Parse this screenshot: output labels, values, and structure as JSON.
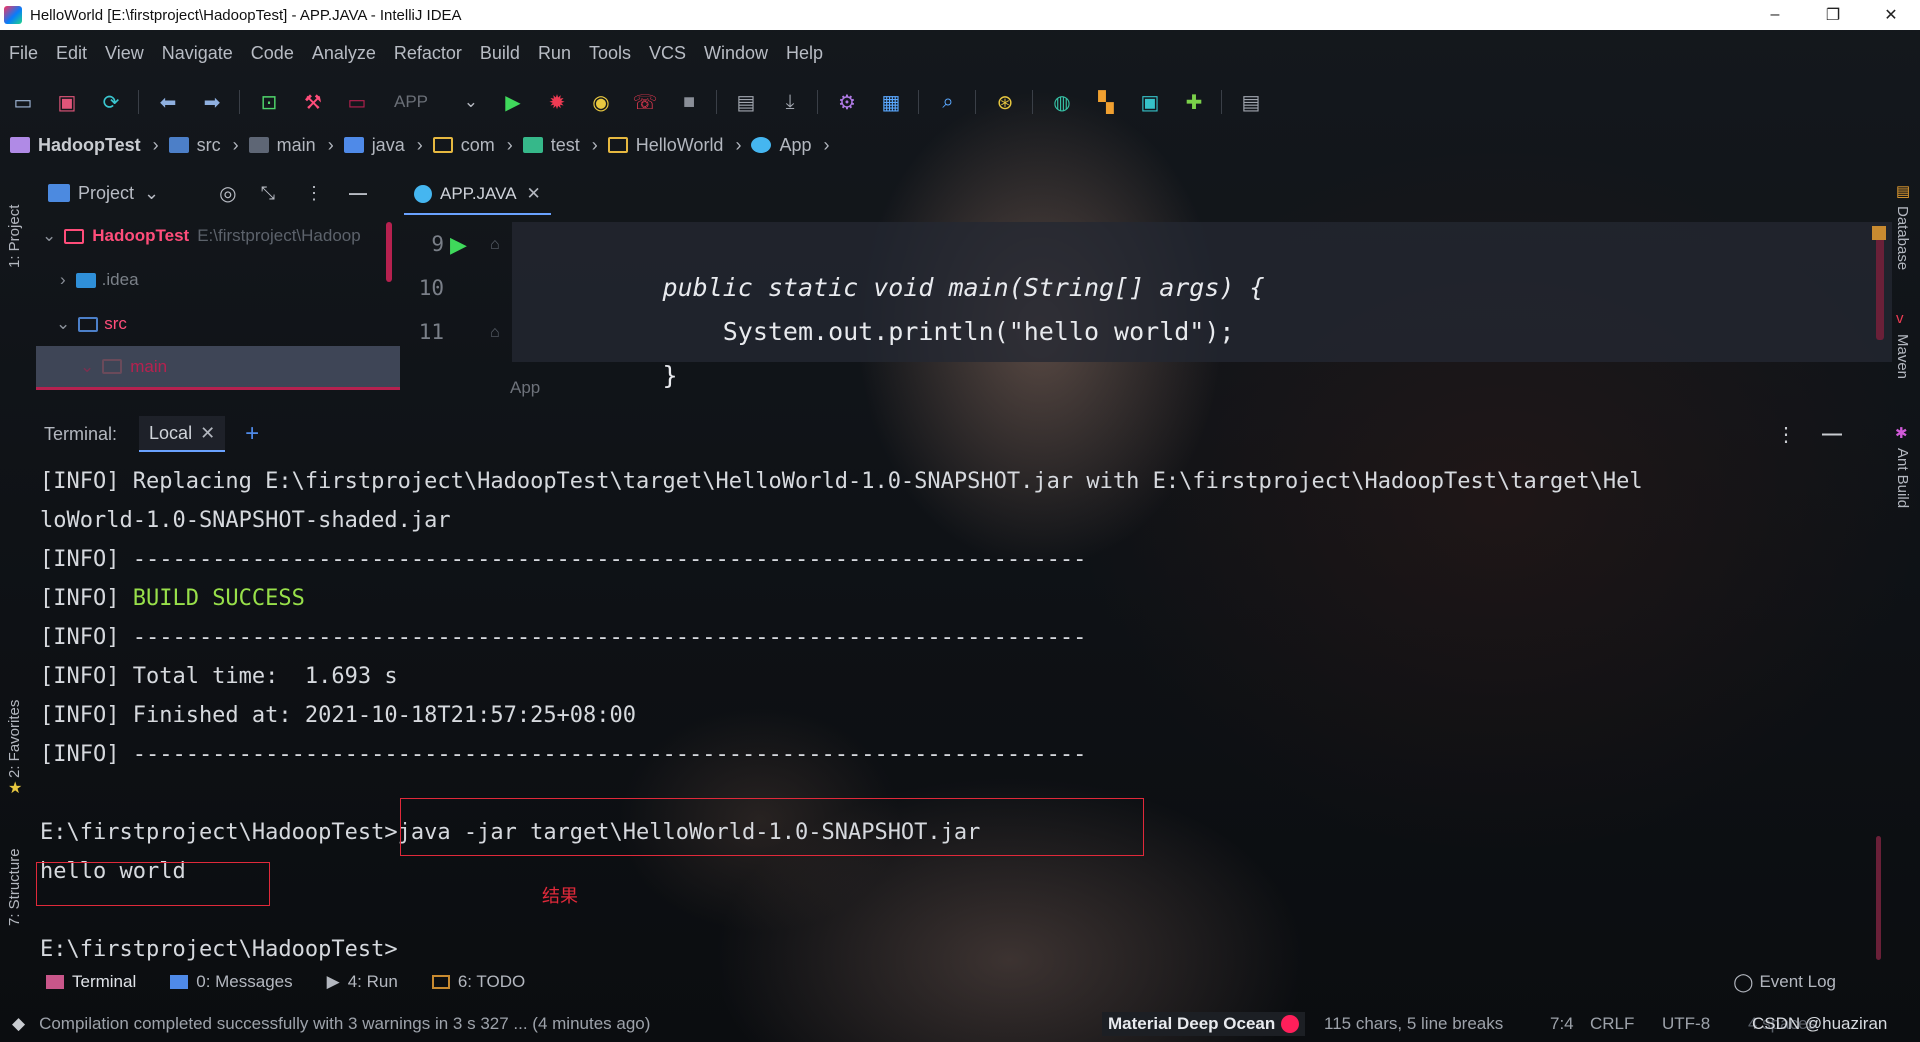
{
  "window": {
    "title": "HelloWorld [E:\\firstproject\\HadoopTest] - APP.JAVA - IntelliJ IDEA",
    "minimize": "–",
    "restore": "❐",
    "close": "✕"
  },
  "menu": [
    "File",
    "Edit",
    "View",
    "Navigate",
    "Code",
    "Analyze",
    "Refactor",
    "Build",
    "Run",
    "Tools",
    "VCS",
    "Window",
    "Help"
  ],
  "toolbar": {
    "run_config": "APP",
    "icons": [
      "open-folder-icon",
      "save-icon",
      "sync-icon",
      "back-icon",
      "forward-icon",
      "terminal-icon",
      "build-hammer-icon",
      "config-icon",
      "run-icon",
      "debug-icon",
      "coverage-icon",
      "profile-icon",
      "stop-icon",
      "ant-icon",
      "download-icon",
      "settings-icon",
      "structure-icon",
      "search-icon",
      "plugin-icon",
      "sdk-icon",
      "layout-icon",
      "dashboard-icon",
      "puzzle-icon",
      "presentation-icon"
    ]
  },
  "breadcrumb": [
    "HadoopTest",
    "src",
    "main",
    "java",
    "com",
    "test",
    "HelloWorld",
    "App"
  ],
  "left_stripe": {
    "project": "1: Project",
    "favorites": "2: Favorites",
    "structure": "7: Structure"
  },
  "right_stripe": {
    "database": "Database",
    "maven": "Maven",
    "ant": "Ant Build"
  },
  "project_panel": {
    "title": "Project",
    "root": {
      "name": "HadoopTest",
      "path": "E:\\firstproject\\Hadoop"
    },
    "items": [
      ".idea",
      "src",
      "main"
    ]
  },
  "editor": {
    "tab": "APP.JAVA",
    "lines": [
      {
        "num": "9",
        "text": "    public static void main(String[] args) {"
      },
      {
        "num": "10",
        "text": "        System.out.println(\"hello world\");"
      },
      {
        "num": "11",
        "text": "    }"
      }
    ],
    "footer_crumb": "App"
  },
  "terminal": {
    "label": "Terminal:",
    "tab": "Local",
    "output": [
      {
        "text": "[INFO] Replacing E:\\firstproject\\HadoopTest\\target\\HelloWorld-1.0-SNAPSHOT.jar with E:\\firstproject\\HadoopTest\\target\\Hel",
        "kind": "plain"
      },
      {
        "text": "loWorld-1.0-SNAPSHOT-shaded.jar",
        "kind": "plain"
      },
      {
        "text": "[INFO] ------------------------------------------------------------------------",
        "kind": "plain"
      },
      {
        "prefix": "[INFO] ",
        "text": "BUILD SUCCESS",
        "kind": "success"
      },
      {
        "text": "[INFO] ------------------------------------------------------------------------",
        "kind": "plain"
      },
      {
        "text": "[INFO] Total time:  1.693 s",
        "kind": "plain"
      },
      {
        "text": "[INFO] Finished at: 2021-10-18T21:57:25+08:00",
        "kind": "plain"
      },
      {
        "text": "[INFO] ------------------------------------------------------------------------",
        "kind": "plain"
      }
    ],
    "prompt_command": "E:\\firstproject\\HadoopTest>java -jar target\\HelloWorld-1.0-SNAPSHOT.jar",
    "result_line": "hello world",
    "annotation": "结果",
    "final_prompt": "E:\\firstproject\\HadoopTest>"
  },
  "bottom_tools": [
    {
      "label": "Terminal",
      "icon": "terminal-icon"
    },
    {
      "label": "0: Messages",
      "icon": "messages-icon"
    },
    {
      "label": "4: Run",
      "icon": "run-icon"
    },
    {
      "label": "6: TODO",
      "icon": "todo-icon"
    }
  ],
  "event_log": "Event Log",
  "status": {
    "message": "Compilation completed successfully with 3 warnings in 3 s 327 ... (4 minutes ago)",
    "theme": "Material Deep Ocean",
    "chars": "115 chars, 5 line breaks",
    "position": "7:4",
    "line_sep": "CRLF",
    "encoding": "UTF-8",
    "indent": "4 spaces",
    "watermark": "CSDN @huaziran"
  },
  "colors": {
    "accent_red": "#e0293a",
    "success_green": "#98e04a",
    "project_pink": "#ff4d7a",
    "run_green": "#3fd95b",
    "debug_red": "#ef3b53"
  }
}
